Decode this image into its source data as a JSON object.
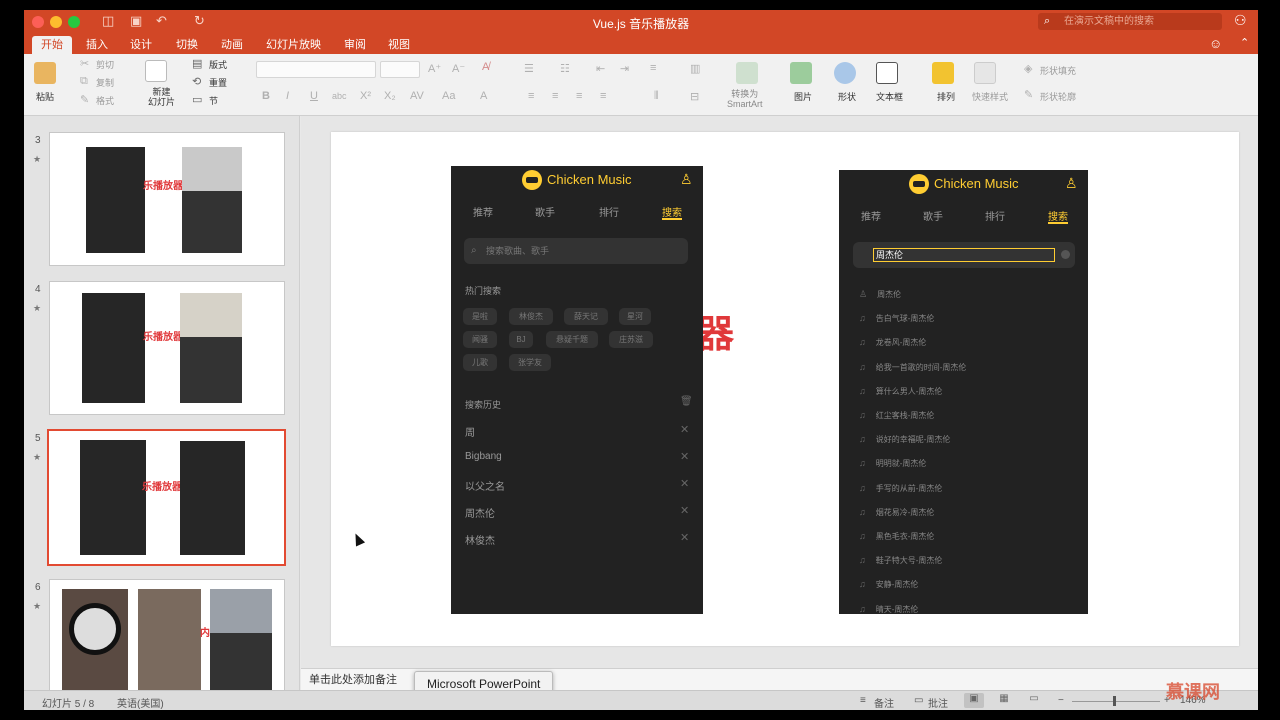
{
  "app": {
    "window_title": "Vue.js 音乐播放器",
    "search_placeholder": "在演示文稿中的搜索"
  },
  "ribbon_tabs": [
    "开始",
    "插入",
    "设计",
    "切换",
    "动画",
    "幻灯片放映",
    "审阅",
    "视图"
  ],
  "ribbon": {
    "paste": "粘贴",
    "cut": "剪切",
    "copy": "复制",
    "format": "格式",
    "new_slide_line1": "新建",
    "new_slide_line2": "幻灯片",
    "layout": "版式",
    "reset": "重置",
    "section": "节",
    "convert_line1": "转换为",
    "convert_line2": "SmartArt",
    "picture": "图片",
    "shape": "形状",
    "textbox": "文本框",
    "arrange": "排列",
    "quick_styles": "快速样式",
    "shape_fill": "形状填充",
    "shape_outline": "形状轮廓"
  },
  "slides": [
    {
      "num": "3",
      "label": "乐播放器"
    },
    {
      "num": "4",
      "label": "乐播放器"
    },
    {
      "num": "5",
      "label": "乐播放器"
    },
    {
      "num": "6",
      "label": "内"
    }
  ],
  "slide": {
    "big_text": "乐播放器",
    "left_phone": {
      "title": "Chicken Music",
      "tabs": [
        "推荐",
        "歌手",
        "排行",
        "搜索"
      ],
      "search_placeholder": "搜索歌曲、歌手",
      "hot_title": "热门搜索",
      "hot_tags": [
        "是啦",
        "林俊杰",
        "薛天记",
        "星河",
        "闻骚",
        "BJ",
        "悬疑千题",
        "庄苏滋",
        "儿歌",
        "张学友"
      ],
      "history_title": "搜索历史",
      "history": [
        "周",
        "Bigbang",
        "以父之名",
        "周杰伦",
        "林俊杰"
      ]
    },
    "right_phone": {
      "title": "Chicken Music",
      "tabs": [
        "推荐",
        "歌手",
        "排行",
        "搜索"
      ],
      "query": "周杰伦",
      "suggestions": [
        "周杰伦",
        "告白气球-周杰伦",
        "龙卷风-周杰伦",
        "给我一首歌的时间-周杰伦",
        "算什么男人-周杰伦",
        "红尘客栈-周杰伦",
        "说好的幸福呢-周杰伦",
        "明明就-周杰伦",
        "手写的从前-周杰伦",
        "烟花易冷-周杰伦",
        "黑色毛衣-周杰伦",
        "鞋子特大号-周杰伦",
        "安静-周杰伦",
        "晴天-周杰伦"
      ]
    }
  },
  "notes_placeholder": "单击此处添加备注",
  "tooltip": "Microsoft PowerPoint",
  "status": {
    "slide_info": "幻灯片 5 / 8",
    "language": "英语(美国)",
    "notes": "备注",
    "comments": "批注",
    "zoom": "146%"
  },
  "watermark": "慕课网",
  "colors": {
    "accent": "#d24726",
    "phone_bg": "#222222",
    "phone_accent": "#ffcd32",
    "slide_text": "#e0383a"
  }
}
